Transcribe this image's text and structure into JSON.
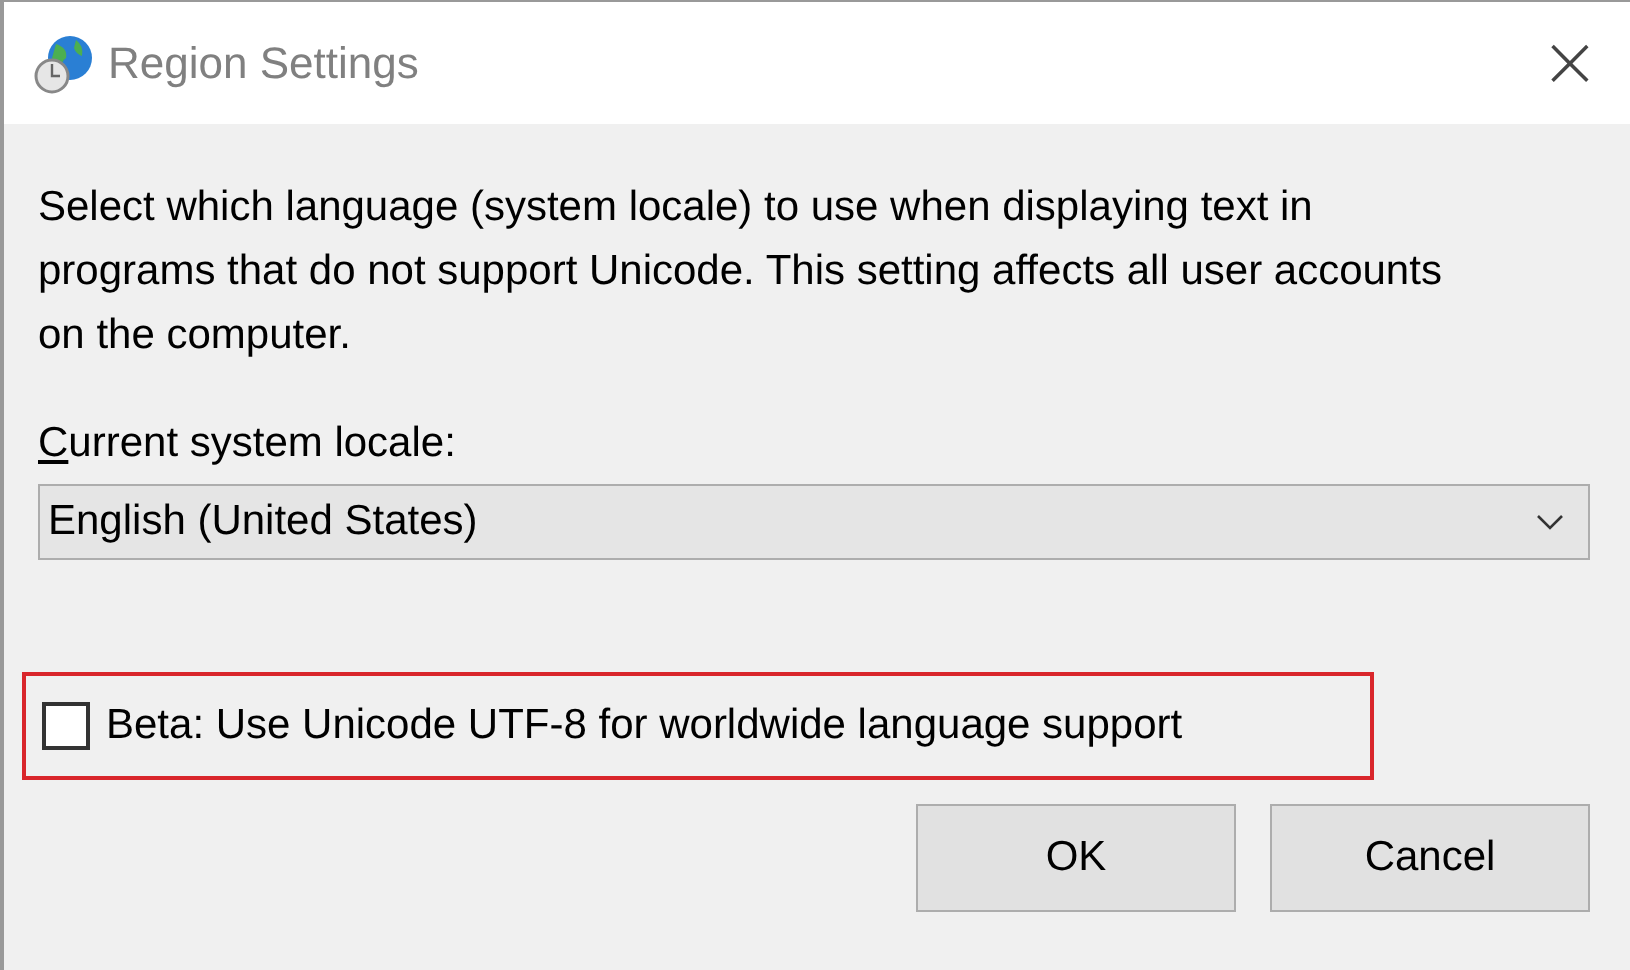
{
  "window": {
    "title": "Region Settings",
    "close": "×"
  },
  "description": "Select which language (system locale) to use when displaying text in programs that do not support Unicode. This setting affects all user accounts on the computer.",
  "locale_label": {
    "text": "Current system locale:",
    "access_key_underlined": true
  },
  "locale_select": {
    "value": "English (United States)"
  },
  "beta_checkbox": {
    "label": "Beta: Use Unicode UTF-8 for worldwide language support",
    "checked": false,
    "highlighted": true
  },
  "buttons": [
    {
      "label": "OK"
    },
    {
      "label": "Cancel"
    }
  ]
}
